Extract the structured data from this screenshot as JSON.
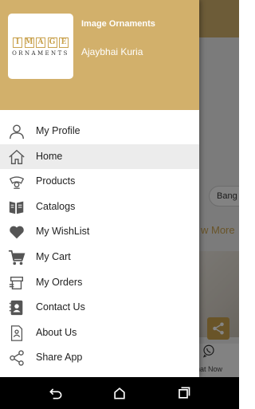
{
  "background": {
    "chip_label": "Bang",
    "view_more": "w More",
    "chat_label": "hat Now"
  },
  "drawer": {
    "header": {
      "company_name": "Image Ornaments",
      "user_name": "Ajaybhai Kuria",
      "logo": {
        "top": "IMAGE",
        "bottom": "ORNAMENTS"
      }
    },
    "items": [
      {
        "label": "My Profile",
        "icon": "profile-icon"
      },
      {
        "label": "Home",
        "icon": "home-icon",
        "active": true
      },
      {
        "label": "Products",
        "icon": "products-icon"
      },
      {
        "label": "Catalogs",
        "icon": "catalogs-icon"
      },
      {
        "label": "My WishList",
        "icon": "heart-icon"
      },
      {
        "label": "My Cart",
        "icon": "cart-icon"
      },
      {
        "label": "My Orders",
        "icon": "orders-icon"
      },
      {
        "label": "Contact Us",
        "icon": "contact-icon"
      },
      {
        "label": "About Us",
        "icon": "about-icon"
      },
      {
        "label": "Share App",
        "icon": "share-icon"
      }
    ]
  },
  "colors": {
    "accent": "#d2b06b",
    "gold_text": "#c9a24e",
    "active_item_bg": "#ececec"
  }
}
